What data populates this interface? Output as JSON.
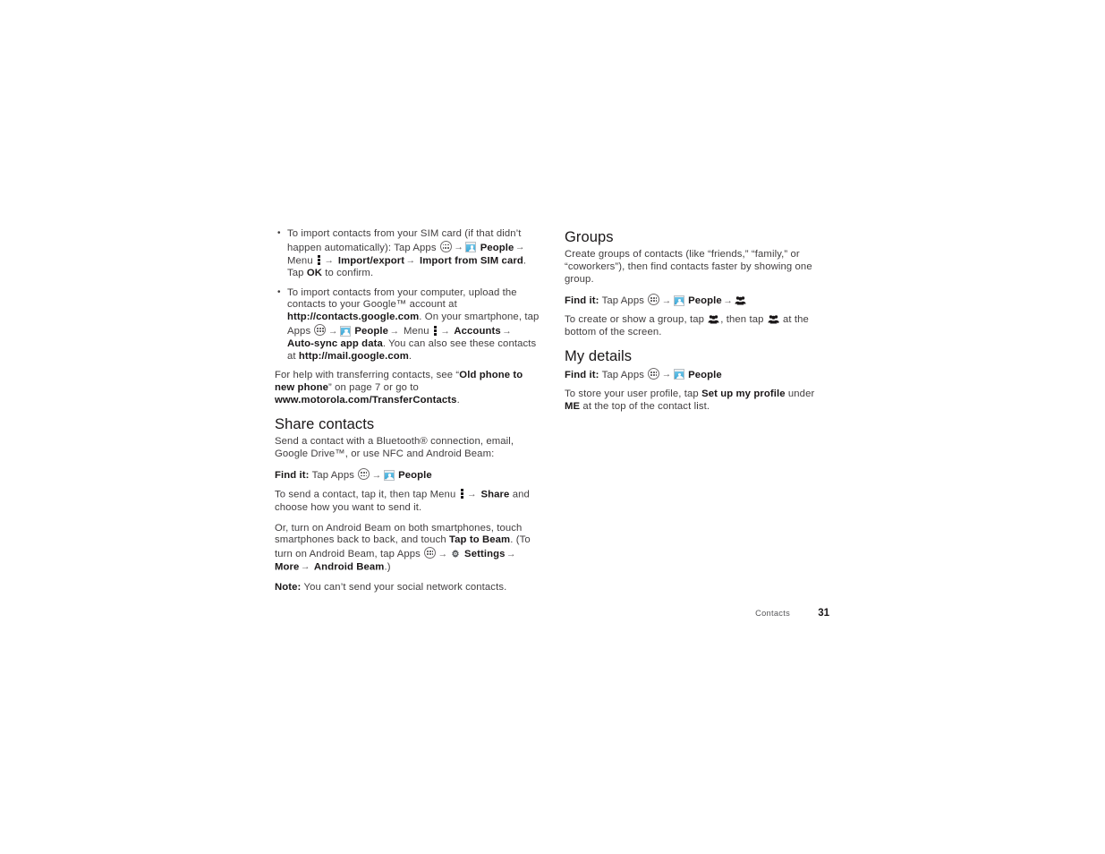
{
  "document": {
    "footer": {
      "chapter": "Contacts",
      "page_number": "31"
    }
  },
  "icons": {
    "apps": "apps-grid-icon",
    "people": "people-app-icon",
    "menu": "menu-vertical-dots-icon",
    "group": "contact-group-icon",
    "group_add": "contact-group-add-icon",
    "gear": "settings-gear-icon",
    "arrow": "→"
  },
  "left_column": {
    "bullets": [
      {
        "parts": [
          {
            "t": "To import contacts from your SIM card (if that didn’t happen automatically): Tap Apps ",
            "b": false
          },
          {
            "icon": "apps"
          },
          {
            "arrow": true
          },
          {
            "icon": "people"
          },
          {
            "t": " People",
            "b": true
          },
          {
            "arrow": true
          },
          {
            "t": " Menu ",
            "b": false
          },
          {
            "icon": "menu"
          },
          {
            "arrow": true
          },
          {
            "t": " Import/export",
            "b": true
          },
          {
            "arrow": true
          },
          {
            "t": " Import from SIM card",
            "b": true
          },
          {
            "t": ". Tap ",
            "b": false
          },
          {
            "t": "OK",
            "b": true
          },
          {
            "t": " to confirm.",
            "b": false
          }
        ]
      },
      {
        "parts": [
          {
            "t": "To import contacts from your computer, upload the contacts to your Google™ account at ",
            "b": false
          },
          {
            "t": "http://contacts.google.com",
            "b": true
          },
          {
            "t": ". On your smartphone, tap Apps ",
            "b": false
          },
          {
            "icon": "apps"
          },
          {
            "arrow": true
          },
          {
            "icon": "people"
          },
          {
            "t": " People",
            "b": true
          },
          {
            "arrow": true
          },
          {
            "t": " Menu ",
            "b": false
          },
          {
            "icon": "menu"
          },
          {
            "arrow": true
          },
          {
            "t": " Accounts",
            "b": true
          },
          {
            "arrow": true
          },
          {
            "t": " Auto-sync app data",
            "b": true
          },
          {
            "t": ". You can also see these contacts at ",
            "b": false
          },
          {
            "t": "http://mail.google.com",
            "b": true
          },
          {
            "t": ".",
            "b": false
          }
        ]
      }
    ],
    "transfer_help": {
      "parts": [
        {
          "t": "For help with transferring contacts, see “",
          "b": false
        },
        {
          "t": "Old phone to new phone",
          "b": true
        },
        {
          "t": "” on page 7 or go to ",
          "b": false
        },
        {
          "t": "www.motorola.com/TransferContacts",
          "b": true
        },
        {
          "t": ".",
          "b": false
        }
      ]
    },
    "share_contacts": {
      "heading": "Share contacts",
      "intro": {
        "parts": [
          {
            "t": "Send a contact with a Bluetooth® connection, email, Google Drive™, or use NFC and Android Beam:",
            "b": false
          }
        ]
      },
      "find_it": {
        "parts": [
          {
            "t": "Find it:",
            "b": true
          },
          {
            "t": " Tap Apps ",
            "b": false
          },
          {
            "icon": "apps"
          },
          {
            "arrow": true
          },
          {
            "icon": "people"
          },
          {
            "t": " People",
            "b": true
          }
        ]
      },
      "send_para": {
        "parts": [
          {
            "t": "To send a contact, tap it, then tap Menu ",
            "b": false
          },
          {
            "icon": "menu"
          },
          {
            "arrow": true
          },
          {
            "t": " Share",
            "b": true
          },
          {
            "t": " and choose how you want to send it.",
            "b": false
          }
        ]
      },
      "beam_para": {
        "parts": [
          {
            "t": "Or, turn on Android Beam on both smartphones, touch smartphones back to back, and touch ",
            "b": false
          },
          {
            "t": "Tap to Beam",
            "b": true
          },
          {
            "t": ". (To turn on Android Beam, tap Apps ",
            "b": false
          },
          {
            "icon": "apps"
          },
          {
            "arrow": true
          },
          {
            "icon": "gear"
          },
          {
            "t": " Settings",
            "b": true
          },
          {
            "arrow": true
          },
          {
            "t": " More",
            "b": true
          },
          {
            "arrow": true
          },
          {
            "t": " Android Beam",
            "b": true
          },
          {
            "t": ".)",
            "b": false
          }
        ]
      },
      "note_para": {
        "parts": [
          {
            "t": "Note:",
            "b": true
          },
          {
            "t": " You can’t send your social network contacts.",
            "b": false
          }
        ]
      }
    }
  },
  "right_column": {
    "groups": {
      "heading": "Groups",
      "intro": {
        "parts": [
          {
            "t": "Create groups of contacts (like “friends,” “family,” or “coworkers”), then find contacts faster by showing one group.",
            "b": false
          }
        ]
      },
      "find_it": {
        "parts": [
          {
            "t": "Find it:",
            "b": true
          },
          {
            "t": " Tap Apps ",
            "b": false
          },
          {
            "icon": "apps"
          },
          {
            "arrow": true
          },
          {
            "icon": "people"
          },
          {
            "t": " People",
            "b": true
          },
          {
            "arrow": true
          },
          {
            "icon": "group"
          }
        ]
      },
      "create_para": {
        "parts": [
          {
            "t": "To create or show a group, tap ",
            "b": false
          },
          {
            "icon": "group"
          },
          {
            "t": ", then tap ",
            "b": false
          },
          {
            "icon": "group_add"
          },
          {
            "t": " at the bottom of the screen.",
            "b": false
          }
        ]
      }
    },
    "my_details": {
      "heading": "My details",
      "find_it": {
        "parts": [
          {
            "t": "Find it:",
            "b": true
          },
          {
            "t": " Tap Apps ",
            "b": false
          },
          {
            "icon": "apps"
          },
          {
            "arrow": true
          },
          {
            "icon": "people"
          },
          {
            "t": " People",
            "b": true
          }
        ]
      },
      "store_para": {
        "parts": [
          {
            "t": "To store your user profile, tap ",
            "b": false
          },
          {
            "t": "Set up my profile",
            "b": true
          },
          {
            "t": " under ",
            "b": false
          },
          {
            "t": "ME",
            "b": true
          },
          {
            "t": " at the top of the contact list.",
            "b": false
          }
        ]
      }
    }
  }
}
